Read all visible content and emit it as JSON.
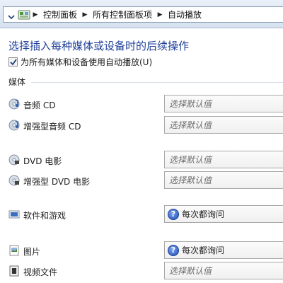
{
  "breadcrumb": {
    "items": [
      "控制面板",
      "所有控制面板项",
      "自动播放"
    ]
  },
  "page": {
    "title": "选择插入每种媒体或设备时的后续操作",
    "autoplay_checkbox_label": "为所有媒体和设备使用自动播放(U)",
    "autoplay_checked": true,
    "section_label": "媒体"
  },
  "media": [
    {
      "label": "音频 CD",
      "icon": "audio-cd-icon",
      "select_value": "选择默认值",
      "select_icon": null
    },
    {
      "label": "增强型音频 CD",
      "icon": "enhanced-audio-cd-icon",
      "select_value": "选择默认值",
      "select_icon": null
    },
    {
      "label": "DVD 电影",
      "icon": "dvd-movie-icon",
      "select_value": "选择默认值",
      "select_icon": null
    },
    {
      "label": "增强型 DVD 电影",
      "icon": "enhanced-dvd-movie-icon",
      "select_value": "选择默认值",
      "select_icon": null
    },
    {
      "label": "软件和游戏",
      "icon": "software-games-icon",
      "select_value": "每次都询问",
      "select_icon": "question-icon"
    },
    {
      "label": "图片",
      "icon": "pictures-icon",
      "select_value": "每次都询问",
      "select_icon": "question-icon"
    },
    {
      "label": "视频文件",
      "icon": "video-files-icon",
      "select_value": "选择默认值",
      "select_icon": null
    }
  ],
  "colors": {
    "title": "#1f3f99",
    "addressbar": "#d6e1ef"
  }
}
